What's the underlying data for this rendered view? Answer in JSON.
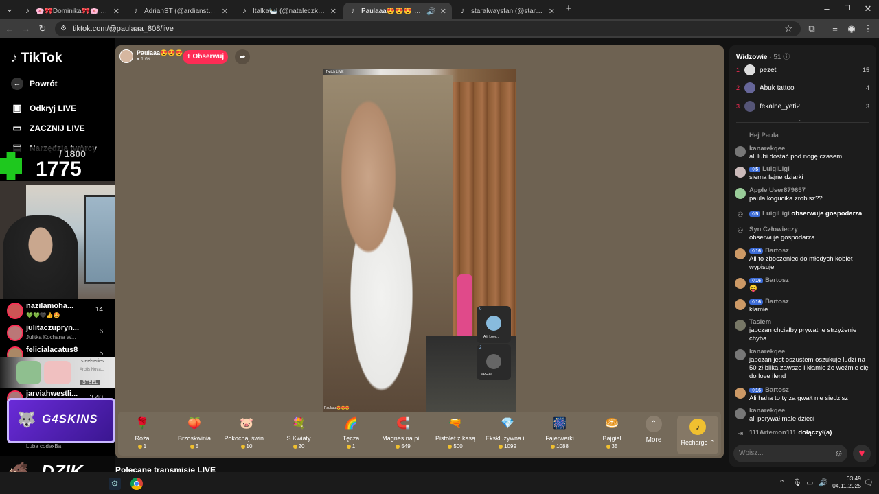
{
  "browser": {
    "tabs": [
      {
        "title": "🌸🎀Dominika🎀🌸 (@domi..."
      },
      {
        "title": "AdrianST (@ardianstx) prowadzi..."
      },
      {
        "title": "Italka🛀 (@nataleczka.mar..."
      },
      {
        "title": "Paulaaa😍😍😍 (@paulaa..."
      },
      {
        "title": "staralwaysfan (@staralwaysfan..."
      }
    ],
    "active_tab": 3,
    "url": "tiktok.com/@paulaaa_808/live"
  },
  "sidebar": {
    "logo": "TikTok",
    "back": "Powrót",
    "nav": [
      {
        "label": "Odkryj LIVE",
        "icon": "tv-icon"
      },
      {
        "label": "ZACZNIJ LIVE",
        "icon": "camera-icon"
      },
      {
        "label": "Narzędzia twórcy",
        "icon": "tools-icon"
      }
    ],
    "counter": {
      "current": "1775",
      "total": "/ 1800"
    },
    "follows": [
      {
        "name": "nazilamoha...",
        "sub": "💚💚🖤👍🤩",
        "count": "14"
      },
      {
        "name": "julitaczupryn...",
        "sub": "Julitka Kochana W...",
        "count": "6"
      },
      {
        "name": "felicialacatus8",
        "sub": "",
        "count": "5"
      },
      {
        "name": "jarviahwestli...",
        "sub": "",
        "count": "3.40"
      },
      {
        "name": "",
        "sub": "Luba codexBa",
        "count": ""
      }
    ],
    "overlay_ad": {
      "brand": "G4SKINS"
    },
    "overlay_brand": "DZIK",
    "steelseries": {
      "brand": "steelseries",
      "line1": "Arctis Nova...",
      "line2": "STEEL"
    }
  },
  "stream": {
    "host_name": "Paulaaa😍😍😍",
    "host_likes": "1.6K",
    "follow_label": "+ Obserwuj",
    "video_caption_top": "Twitch LIVE",
    "video_caption_bottom": "Paulaaa😍😍😍",
    "guests": [
      {
        "name": "Ali_Love..."
      },
      {
        "name": "japczan"
      }
    ],
    "guest_counts": [
      "0",
      "2"
    ],
    "gifts": [
      {
        "name": "Róża",
        "price": "1",
        "icon": "🌹",
        "color": "#e33"
      },
      {
        "name": "Brzoskwinia",
        "price": "5",
        "icon": "🍑",
        "color": "#f88"
      },
      {
        "name": "Pokochaj świn...",
        "price": "10",
        "icon": "🐷",
        "color": "#f9b"
      },
      {
        "name": "S Kwiaty",
        "price": "20",
        "icon": "💐",
        "color": "#d44"
      },
      {
        "name": "Tęcza",
        "price": "1",
        "icon": "🌈",
        "color": "#fa3"
      },
      {
        "name": "Magnes na pi...",
        "price": "549",
        "icon": "🧲",
        "color": "#8ad"
      },
      {
        "name": "Pistolet z kasą",
        "price": "500",
        "icon": "🔫",
        "color": "#e9c"
      },
      {
        "name": "Ekskluzywna i...",
        "price": "1099",
        "icon": "💎",
        "color": "#dbe"
      },
      {
        "name": "Fajerwerki",
        "price": "1088",
        "icon": "🎆",
        "color": "#9bd"
      },
      {
        "name": "Bajgiel",
        "price": "35",
        "icon": "🥯",
        "color": "#da5"
      }
    ],
    "more_label": "More",
    "recharge_label": "Recharge",
    "recommended": "Polecane transmisje LIVE"
  },
  "chat": {
    "viewers_title": "Widzowie",
    "viewers_count": "51",
    "top_viewers": [
      {
        "rank": "1",
        "name": "pezet",
        "score": "15",
        "color": "#ddd"
      },
      {
        "rank": "2",
        "name": "Abuk tattoo",
        "score": "4",
        "color": "#669"
      },
      {
        "rank": "3",
        "name": "fekalne_yeti2",
        "score": "3",
        "color": "#557"
      }
    ],
    "pinned": "Hej Paula",
    "messages": [
      {
        "name": "kanarekqee",
        "level": "",
        "text": "ali lubi dostać pod nogę czasem"
      },
      {
        "name": "LuigiLigi",
        "level": "5",
        "text": "siema fajne dziarki"
      },
      {
        "name": "Apple User879657",
        "level": "",
        "text": "paula kogucika zrobisz??"
      },
      {
        "name": "LuigiLigi",
        "level": "5",
        "text": "obserwuje gospodarza"
      },
      {
        "name": "Syn Człowieczy",
        "level": "",
        "text": "obserwuje gospodarza"
      },
      {
        "name": "Bartosz",
        "level": "16",
        "text": "Ali to zboczeniec do młodych kobiet wypisuje"
      },
      {
        "name": "Bartosz",
        "level": "16",
        "text": "😝"
      },
      {
        "name": "Bartosz",
        "level": "16",
        "text": "kłamie"
      },
      {
        "name": "Tasiem",
        "level": "",
        "text": "japczan chciałby prywatne strzyżenie chyba"
      },
      {
        "name": "kanarekqee",
        "level": "",
        "text": "japczan jest oszustem oszukuje ludzi na 50 zł blika zawsze i kłamie że weźmie cię do love ilend"
      },
      {
        "name": "Bartosz",
        "level": "16",
        "text": "Ali haha to ty za gwałt nie siedzisz"
      },
      {
        "name": "kanarekqee",
        "level": "",
        "text": "ali porywał małe dzieci"
      }
    ],
    "join_event": {
      "name": "111Artemon111",
      "text": "dołączył(a)"
    },
    "input_placeholder": "Wpisz..."
  },
  "taskbar": {
    "time": "03:49",
    "date": "04.11.2025"
  }
}
